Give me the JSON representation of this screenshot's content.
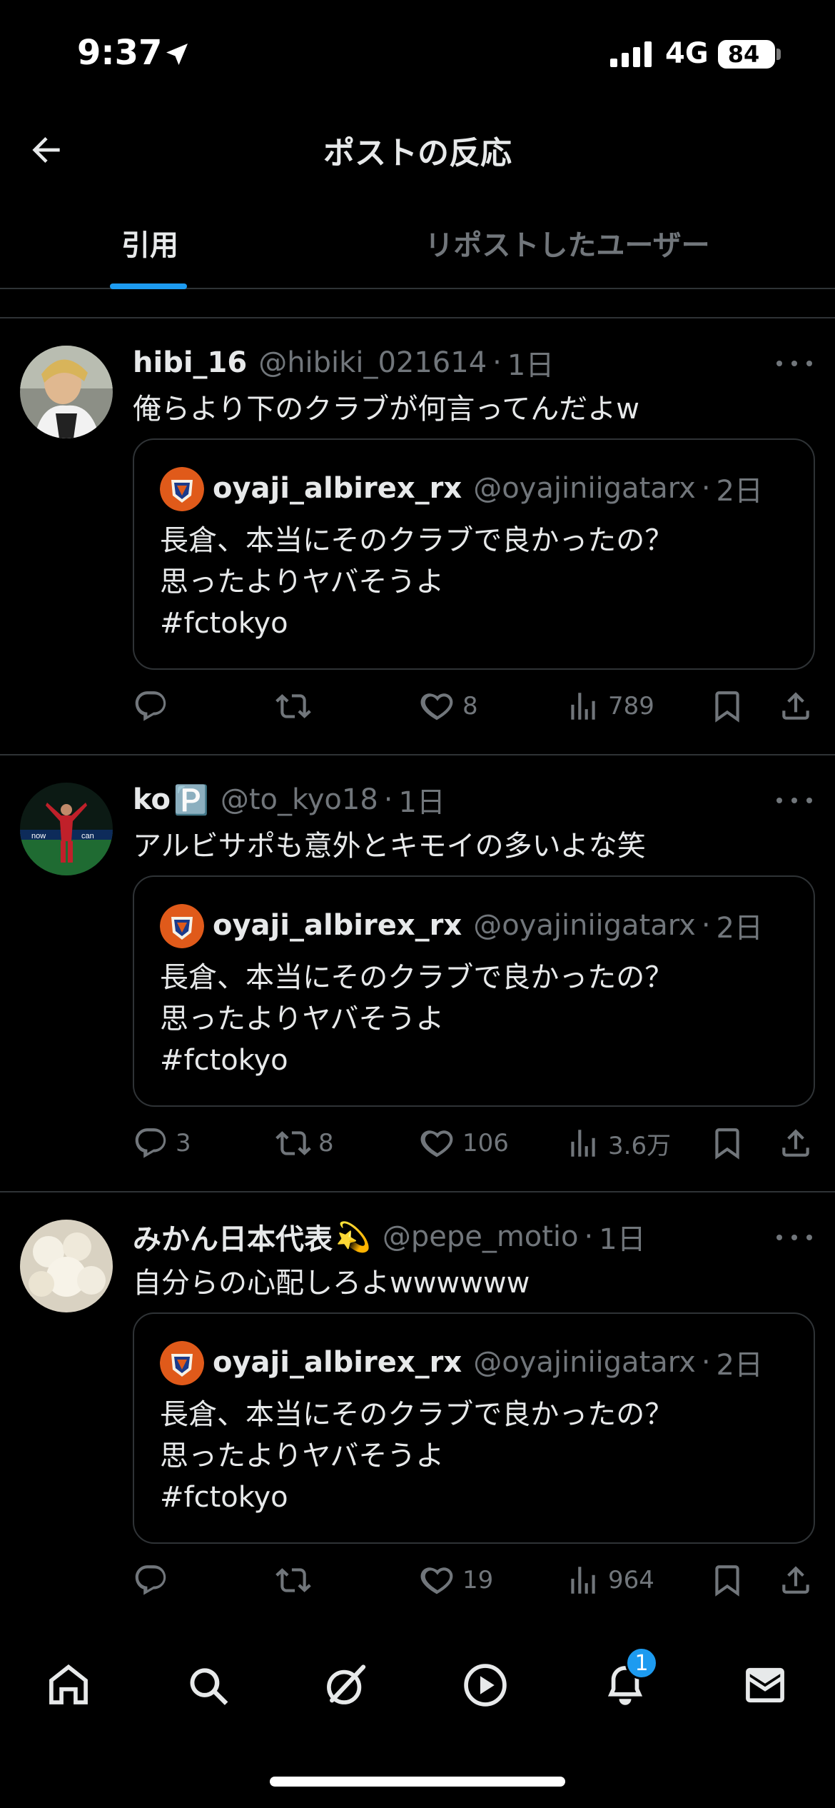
{
  "status_bar": {
    "time": "9:37",
    "network": "4G",
    "battery": "84"
  },
  "header": {
    "title": "ポストの反応"
  },
  "tabs": [
    {
      "label": "引用",
      "active": true
    },
    {
      "label": "リポストしたユーザー",
      "active": false
    }
  ],
  "quoted_post": {
    "name": "oyaji_albirex_rx",
    "handle": "@oyajiniigatarx",
    "time": "2日",
    "lines": [
      "長倉、本当にそのクラブで良かったの？",
      "思ったよりヤバそうよ",
      "#fctokyo"
    ]
  },
  "posts": [
    {
      "name": "hibi_16",
      "badge": "",
      "handle": "@hibiki_021614",
      "time": "1日",
      "text": "俺らより下のクラブが何言ってんだよw",
      "replies": "",
      "reposts": "",
      "likes": "8",
      "views": "789"
    },
    {
      "name": "ko",
      "badge": "🅿️",
      "handle": "@to_kyo18",
      "time": "1日",
      "text": "アルビサポも意外とキモイの多いよな笑",
      "replies": "3",
      "reposts": "8",
      "likes": "106",
      "views": "3.6万"
    },
    {
      "name": "みかん日本代表",
      "badge": "💫",
      "handle": "@pepe_motio",
      "time": "1日",
      "text": "自分らの心配しろよwwwwww",
      "replies": "",
      "reposts": "",
      "likes": "19",
      "views": "964"
    }
  ],
  "tabbar": {
    "notification_count": "1"
  },
  "colors": {
    "accent": "#1d9bf0",
    "muted": "#71767b",
    "border": "#2f3336",
    "text": "#e7e9ea"
  }
}
